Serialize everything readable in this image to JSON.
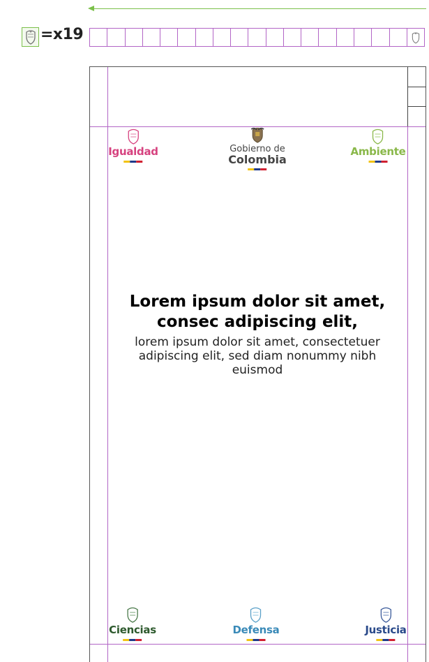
{
  "ruler": {
    "label": "=x19",
    "cells": 19
  },
  "headline": "Lorem ipsum dolor sit amet, consec adipiscing elit,",
  "subtitle": "lorem ipsum dolor sit amet, consectetuer adipiscing elit, sed diam nonummy nibh euismod",
  "header_logos": [
    {
      "name": "Igualdad",
      "color": "#d6427f"
    },
    {
      "name_small": "Gobierno de",
      "name_big": "Colombia",
      "color": "#444444"
    },
    {
      "name": "Ambiente",
      "color": "#8ab84a"
    }
  ],
  "footer_logos": [
    {
      "name": "Ciencias",
      "color": "#2e5a2e"
    },
    {
      "name": "Defensa",
      "color": "#3a8ab8"
    },
    {
      "name": "Justicia",
      "color": "#2a4a8a"
    }
  ],
  "colors": {
    "guide": "#b265c6",
    "arrow": "#7bc04a",
    "flag_yellow": "#f2c314",
    "flag_blue": "#1f3a8a",
    "flag_red": "#d02030"
  },
  "icons": [
    "crest-icon"
  ]
}
